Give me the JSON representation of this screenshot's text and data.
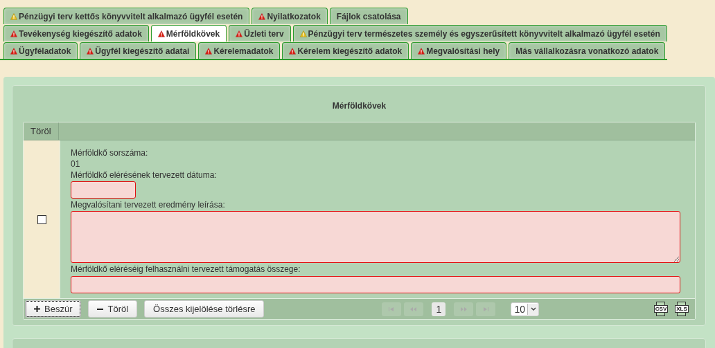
{
  "tab_rows": [
    [
      {
        "label": "Pénzügyi terv kettős könyvvitelt alkalmazó ügyfél esetén",
        "kind": "warning",
        "selected": false
      },
      {
        "label": "Nyilatkozatok",
        "kind": "error",
        "selected": false
      },
      {
        "label": "Fájlok csatolása",
        "kind": "plain",
        "selected": false
      }
    ],
    [
      {
        "label": "Tevékenység kiegészítő adatok",
        "kind": "error",
        "selected": false
      },
      {
        "label": "Mérföldkövek",
        "kind": "error",
        "selected": true
      },
      {
        "label": "Üzleti terv",
        "kind": "error",
        "selected": false
      },
      {
        "label": "Pénzügyi terv természetes személy és egyszerűsített könyvvitelt alkalmazó ügyfél esetén",
        "kind": "warning",
        "selected": false
      }
    ],
    [
      {
        "label": "Ügyféladatok",
        "kind": "error",
        "selected": false
      },
      {
        "label": "Ügyfél kiegészítő adatai",
        "kind": "error",
        "selected": false
      },
      {
        "label": "Kérelemadatok",
        "kind": "error",
        "selected": false
      },
      {
        "label": "Kérelem kiegészítő adatok",
        "kind": "error",
        "selected": false
      },
      {
        "label": "Megvalósítási hely",
        "kind": "error",
        "selected": false
      },
      {
        "label": "Más vállalkozásra vonatkozó adatok",
        "kind": "plain",
        "selected": false
      }
    ]
  ],
  "section": {
    "title": "Mérföldkövek",
    "table": {
      "columns": [
        "Töröl"
      ],
      "rows": [
        {
          "checked": false,
          "fields": [
            {
              "kind": "text",
              "label": "Mérföldkő sorszáma:",
              "value": "01"
            },
            {
              "kind": "short",
              "label": "Mérföldkő elérésének tervezett dátuma:"
            },
            {
              "kind": "area",
              "label": "Megvalósítani tervezett eredmény leírása:"
            },
            {
              "kind": "long",
              "label": "Mérföldkő eléréséig felhasználni tervezett támogatás összege:"
            }
          ]
        }
      ]
    },
    "buttons": [
      {
        "kind": "add",
        "label": "Beszúr",
        "focused": true
      },
      {
        "kind": "remove",
        "label": "Töröl",
        "focused": false
      },
      {
        "kind": "plain",
        "label": "Összes kijelölése törlésre",
        "focused": false
      }
    ],
    "pager": {
      "page": "1",
      "page_size": "10"
    },
    "exports": [
      "CSV",
      "XLS"
    ]
  }
}
